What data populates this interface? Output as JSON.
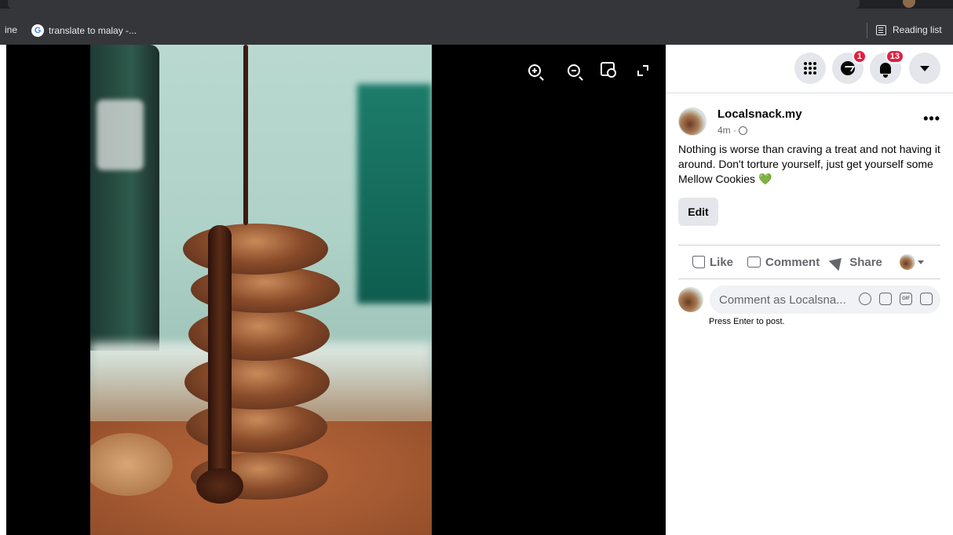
{
  "browser": {
    "bookmarks": [
      {
        "label": "ine"
      },
      {
        "label": "translate to malay -..."
      }
    ],
    "reading_list_label": "Reading list"
  },
  "viewer": {
    "tools": [
      "zoom-in-icon",
      "zoom-out-icon",
      "tag-icon",
      "fullscreen-icon"
    ]
  },
  "header": {
    "messenger_badge": "1",
    "notifications_badge": "13"
  },
  "post": {
    "page_name": "Localsnack.my",
    "time": "4m ·",
    "text": "Nothing is worse than craving a treat and not having it around. Don't torture yourself, just get yourself some Mellow Cookies",
    "emoji": "💚",
    "edit_label": "Edit"
  },
  "actions": {
    "like": "Like",
    "comment": "Comment",
    "share": "Share"
  },
  "comment_box": {
    "placeholder": "Comment as Localsna...",
    "hint": "Press Enter to post."
  }
}
